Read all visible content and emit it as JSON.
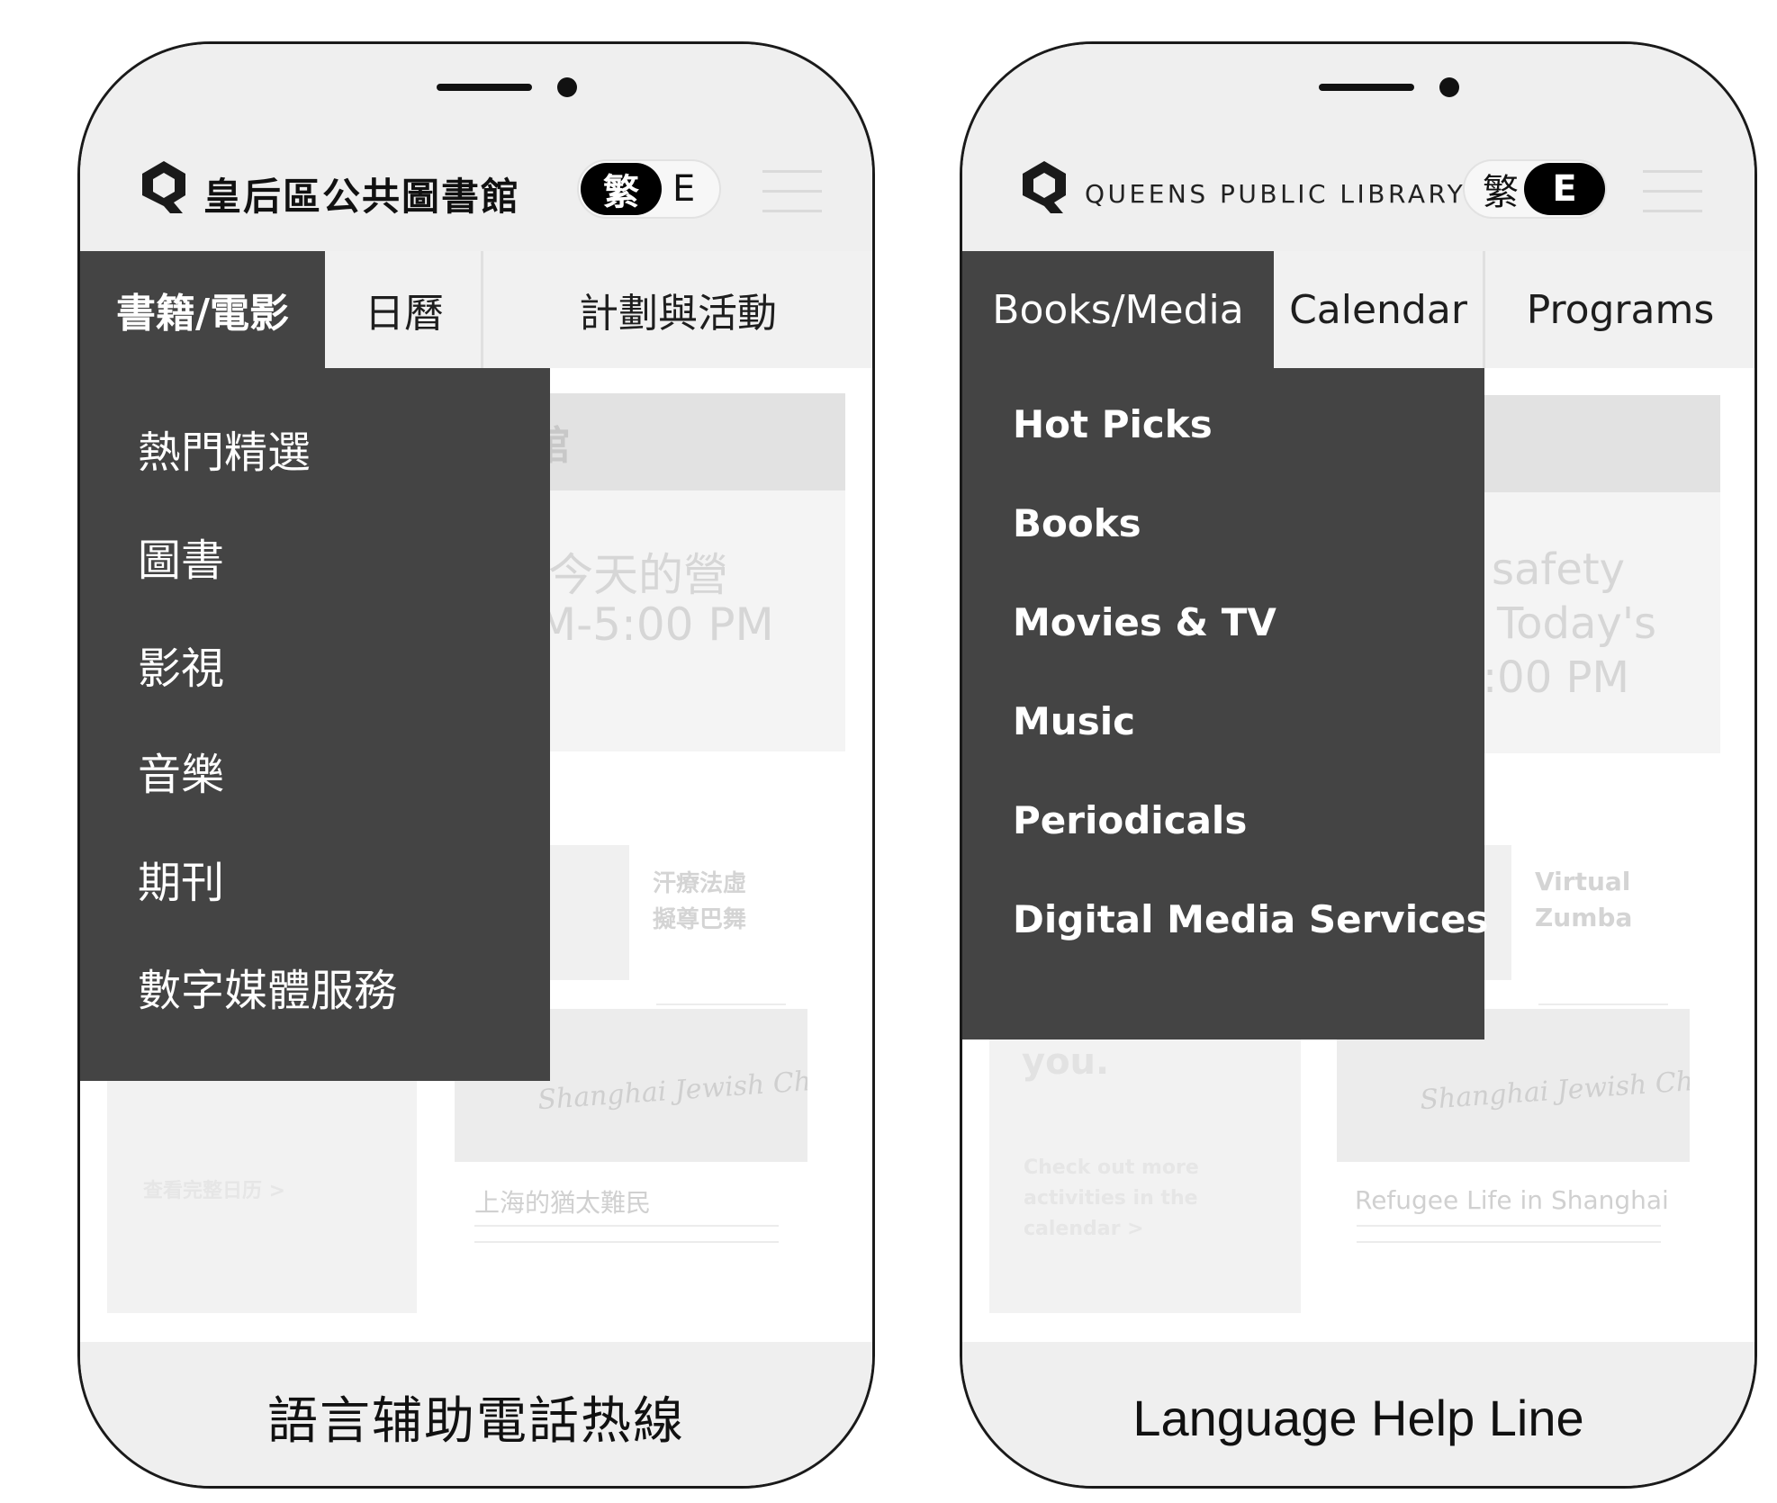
{
  "phones": {
    "zh": {
      "brand": "皇后區公共圖書館",
      "lang_toggle": {
        "left": "繁",
        "right": "E",
        "active": "left"
      },
      "tabs": [
        {
          "label": "書籍/電影",
          "active": true
        },
        {
          "label": "日曆",
          "active": false
        },
        {
          "label": "計劃與活動",
          "active": false
        }
      ],
      "dropdown_items": [
        "熱門精選",
        "圖書",
        "影視",
        "音樂",
        "期刊",
        "數字媒體服務"
      ],
      "background": {
        "banner_text": "馆",
        "event_line1": "今天的營",
        "event_line2": "M-5:00 PM",
        "card1_line1": "汗療法虛",
        "card1_line2": "擬尊巴舞",
        "calendar_link": "查看完整日历 >",
        "card2_caption": "上海的猶太難民",
        "newspaper_text": "Shanghai Jewish Chronicle"
      },
      "footer": "語言辅助電話热線"
    },
    "en": {
      "brand": "QUEENS PUBLIC LIBRARY",
      "lang_toggle": {
        "left": "繁",
        "right": "E",
        "active": "right"
      },
      "tabs": [
        {
          "label": "Books/Media",
          "active": true
        },
        {
          "label": "Calendar",
          "active": false
        },
        {
          "label": "Programs",
          "active": false
        }
      ],
      "dropdown_items": [
        "Hot Picks",
        "Books",
        "Movies & TV",
        "Music",
        "Periodicals",
        "Digital Media Services"
      ],
      "background": {
        "event_line1": "safety",
        "event_line2": "Today's",
        "event_line3": ":00 PM",
        "card1_line1": "Virtual",
        "card1_line2": "Zumba",
        "you_text": "you.",
        "calendar_link_line1": "Check out more",
        "calendar_link_line2": "activities in the",
        "calendar_link_line3": "calendar >",
        "card2_caption": "Refugee Life in Shanghai",
        "newspaper_text": "Shanghai Jewish Chronicle"
      },
      "footer": "Language Help Line"
    }
  },
  "colors": {
    "header_bg": "#efefef",
    "active_tab_bg": "#444444",
    "dropdown_bg": "#444444",
    "toggle_active_bg": "#000000",
    "footer_bg": "#efefef"
  }
}
